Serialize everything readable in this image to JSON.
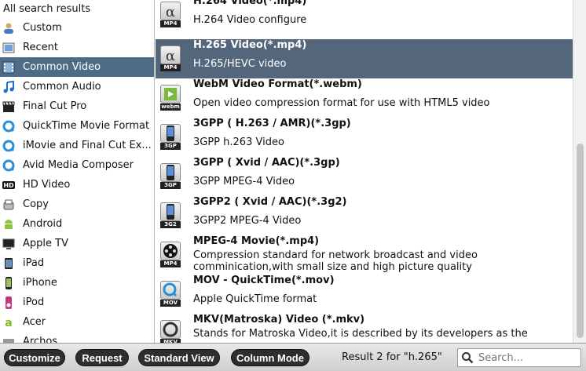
{
  "categories": [
    {
      "label": "All search results",
      "icon": "none-icon"
    },
    {
      "label": "Custom",
      "icon": "user-icon"
    },
    {
      "label": "Recent",
      "icon": "recent-icon"
    },
    {
      "label": "Common Video",
      "icon": "film-icon",
      "selected": true
    },
    {
      "label": "Common Audio",
      "icon": "music-icon"
    },
    {
      "label": "Final Cut Pro",
      "icon": "clapper-icon"
    },
    {
      "label": "QuickTime Movie Format",
      "icon": "quicktime-icon"
    },
    {
      "label": "iMovie and Final Cut Ex...",
      "icon": "quicktime-icon"
    },
    {
      "label": "Avid Media Composer",
      "icon": "quicktime-icon"
    },
    {
      "label": "HD Video",
      "icon": "hd-icon"
    },
    {
      "label": "Copy",
      "icon": "copy-icon"
    },
    {
      "label": "Android",
      "icon": "android-icon"
    },
    {
      "label": "Apple TV",
      "icon": "tv-icon"
    },
    {
      "label": "iPad",
      "icon": "ipad-icon"
    },
    {
      "label": "iPhone",
      "icon": "iphone-icon"
    },
    {
      "label": "iPod",
      "icon": "ipod-icon"
    },
    {
      "label": "Acer",
      "icon": "acer-icon"
    },
    {
      "label": "Archos",
      "icon": "archos-icon"
    }
  ],
  "formats": [
    {
      "title": "H.264 Video(*.mp4)",
      "desc": "H.264 Video configure",
      "badge": "MP4",
      "icon": "alpha-icon"
    },
    {
      "title": "H.265 Video(*.mp4)",
      "desc": "H.265/HEVC video",
      "badge": "MP4",
      "icon": "alpha-icon",
      "selected": true
    },
    {
      "title": "WebM Video Format(*.webm)",
      "desc": "Open video compression format for use with HTML5 video",
      "badge": "webm",
      "icon": "webm-icon"
    },
    {
      "title": "3GPP ( H.263 / AMR)(*.3gp)",
      "desc": "3GPP h.263 Video",
      "badge": "3GP",
      "icon": "phone-icon"
    },
    {
      "title": "3GPP ( Xvid / AAC)(*.3gp)",
      "desc": "3GPP MPEG-4 Video",
      "badge": "3GP",
      "icon": "phone-icon"
    },
    {
      "title": "3GPP2 ( Xvid / AAC)(*.3g2)",
      "desc": "3GPP2 MPEG-4 Video",
      "badge": "3G2",
      "icon": "phone-icon"
    },
    {
      "title": "MPEG-4 Movie(*.mp4)",
      "desc": "Compression standard for network broadcast and video comminication,with small size and high picture quality",
      "badge": "MP4",
      "icon": "reel-icon"
    },
    {
      "title": "MOV - QuickTime(*.mov)",
      "desc": "Apple QuickTime format",
      "badge": "MOV",
      "icon": "quicktime-icon"
    },
    {
      "title": "MKV(Matroska) Video (*.mkv)",
      "desc": "Stands for Matroska Video,it is described by its developers as the",
      "badge": "MKV",
      "icon": "mkv-icon"
    }
  ],
  "toolbar": {
    "customize": "Customize",
    "request": "Request",
    "standard_view": "Standard View",
    "column_mode": "Column Mode"
  },
  "result_text": "Result 2 for \"h.265\"",
  "search": {
    "placeholder": "Search..."
  }
}
